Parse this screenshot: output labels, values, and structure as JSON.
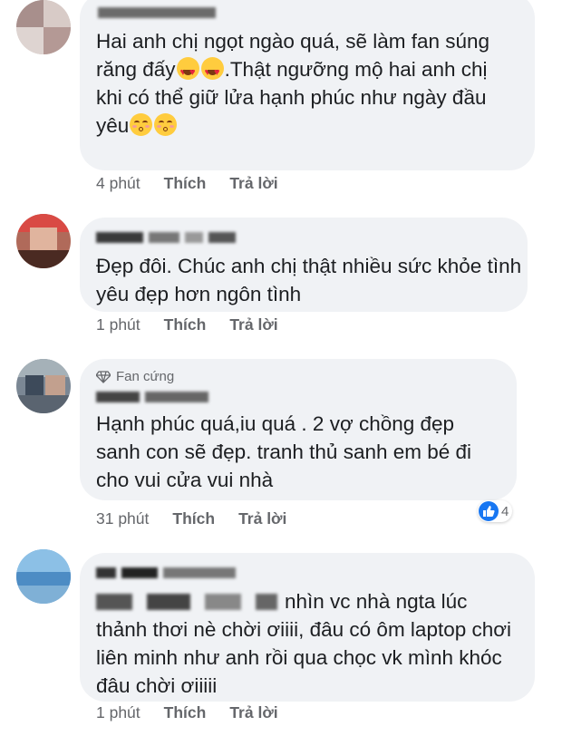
{
  "comments": [
    {
      "text": "Hai anh chị ngọt ngào quá, sẽ làm fan súng răng đấy",
      "text_after_emoji": ".Thật ngưỡng mộ hai anh chị khi có thể giữ lửa hạnh phúc như ngày đầu yêu",
      "time": "4 phút",
      "like": "Thích",
      "reply": "Trả lời"
    },
    {
      "text": "Đẹp đôi. Chúc anh chị thật nhiều sức khỏe tình yêu đẹp hơn ngôn tình",
      "time": "1 phút",
      "like": "Thích",
      "reply": "Trả lời"
    },
    {
      "badge": "Fan cứng",
      "text": "Hạnh phúc quá,iu quá . 2 vợ chồng đẹp sanh con sẽ đẹp. tranh thủ sanh em bé đi cho vui cửa vui nhà",
      "time": "31 phút",
      "like": "Thích",
      "reply": "Trả lời",
      "reaction_count": "4"
    },
    {
      "text": "nhìn vc nhà ngta lúc thảnh thơi nè chời ơiiii, đâu có ôm laptop chơi liên minh như anh rồi qua chọc vk mình khóc đâu chời ơiiiii",
      "time": "1 phút",
      "like": "Thích",
      "reply": "Trả lời"
    }
  ],
  "colors": {
    "bubble": "#f0f2f5",
    "meta": "#65676b",
    "like_blue": "#1877f2"
  }
}
